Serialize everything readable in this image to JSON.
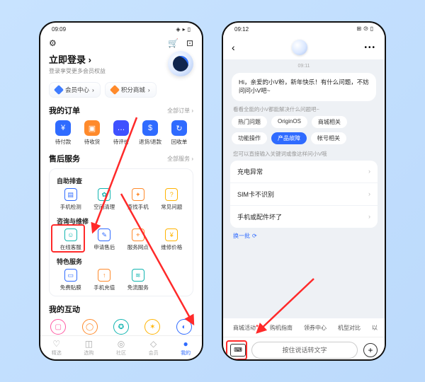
{
  "left": {
    "status_time": "09:09",
    "login_title": "立即登录",
    "login_sub": "登录享受更多会员权益",
    "pills": {
      "member": "会员中心",
      "points": "积分商城"
    },
    "orders_title": "我的订单",
    "orders_more": "全部订单",
    "orders": [
      {
        "label": "待付款",
        "color": "#2f6bff",
        "glyph": "¥"
      },
      {
        "label": "待收货",
        "color": "#ff8a2b",
        "glyph": "▣"
      },
      {
        "label": "待评价",
        "color": "#3f51ff",
        "glyph": "…"
      },
      {
        "label": "退货/退款",
        "color": "#2f6bff",
        "glyph": "$"
      },
      {
        "label": "回收单",
        "color": "#2f6bff",
        "glyph": "↻"
      }
    ],
    "aftersale_title": "售后服务",
    "aftersale_more": "全部服务",
    "selfcheck_title": "自助排查",
    "selfcheck": [
      {
        "label": "手机检测",
        "cls": "c-blue",
        "glyph": "▤"
      },
      {
        "label": "空间清理",
        "cls": "c-teal",
        "glyph": "✿"
      },
      {
        "label": "查找手机",
        "cls": "c-orange",
        "glyph": "✦"
      },
      {
        "label": "常见问题",
        "cls": "c-amber",
        "glyph": "?"
      }
    ],
    "repair_title": "咨询与维修",
    "repair": [
      {
        "label": "在线客服",
        "cls": "c-teal",
        "glyph": "☺"
      },
      {
        "label": "申请售后",
        "cls": "c-blue",
        "glyph": "✎"
      },
      {
        "label": "服务网点",
        "cls": "c-orange",
        "glyph": "⌖"
      },
      {
        "label": "维修价格",
        "cls": "c-amber",
        "glyph": "¥"
      }
    ],
    "feature_title": "特色服务",
    "feature": [
      {
        "label": "免费贴膜",
        "cls": "c-blue",
        "glyph": "▭"
      },
      {
        "label": "手机充值",
        "cls": "c-orange",
        "glyph": "↑"
      },
      {
        "label": "免流服务",
        "cls": "c-teal",
        "glyph": "≋"
      }
    ],
    "interact_title": "我的互动",
    "nav": [
      {
        "label": "精选"
      },
      {
        "label": "选购"
      },
      {
        "label": "社区"
      },
      {
        "label": "会员"
      },
      {
        "label": "我的"
      }
    ]
  },
  "right": {
    "status_time": "09:12",
    "time_small": "09:11",
    "greeting": "Hi，亲爱的小V粉，新年快乐！有什么问题，不妨问问小V吧~",
    "cate_head": "看看全能的小V都能解决什么问题吧~",
    "chips": [
      {
        "label": "热门问题"
      },
      {
        "label": "OriginOS"
      },
      {
        "label": "商城相关"
      },
      {
        "label": "功能操作"
      },
      {
        "label": "产品故障",
        "active": true
      },
      {
        "label": "帐号相关"
      }
    ],
    "faq_note": "您可以直接输入关键词或像这样问小V哦",
    "faq": [
      "充电异常",
      "SIM卡不识别",
      "手机或配件坏了"
    ],
    "refresh": "换一批",
    "bottom_tabs": [
      "商城活动",
      "购机指南",
      "领券中心",
      "机型对比",
      "以"
    ],
    "speak_label": "按住说话转文字"
  }
}
